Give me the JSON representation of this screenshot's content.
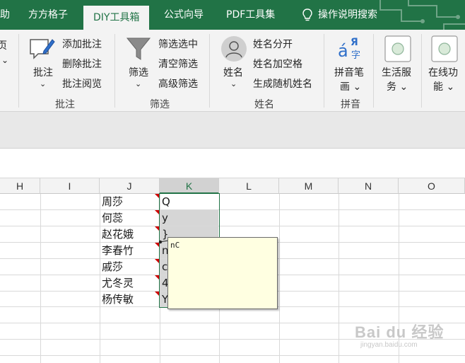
{
  "tabs": [
    {
      "label": "助",
      "active": false
    },
    {
      "label": "方方格子",
      "active": false
    },
    {
      "label": "DIY工具箱",
      "active": true
    },
    {
      "label": "公式向导",
      "active": false
    },
    {
      "label": "PDF工具集",
      "active": false
    }
  ],
  "tell_me": {
    "label": "操作说明搜索"
  },
  "ribbon": {
    "left_cut": {
      "top": "页",
      "bottom": "⌄"
    },
    "comment_group": {
      "large_button": "批注",
      "chevron": "⌄",
      "items": [
        "添加批注",
        "删除批注",
        "批注阅览"
      ],
      "label": "批注"
    },
    "filter_group": {
      "large_button": "筛选",
      "chevron": "⌄",
      "items": [
        "筛选选中",
        "清空筛选",
        "高级筛选"
      ],
      "label": "筛选"
    },
    "name_group": {
      "large_button": "姓名",
      "chevron": "⌄",
      "items": [
        "姓名分开",
        "姓名加空格",
        "生成随机姓名"
      ],
      "label": "姓名"
    },
    "pinyin_group": {
      "icon_letters": "á",
      "icon_cyr": "Я",
      "icon_zi": "字",
      "button_line1": "拼音笔",
      "button_line2": "画 ⌄",
      "label": "拼音"
    },
    "life_service": {
      "line1": "生活服",
      "line2": "务 ⌄"
    },
    "online": {
      "line1": "在线功",
      "line2": "能 ⌄"
    }
  },
  "grid": {
    "columns": [
      "H",
      "I",
      "J",
      "K",
      "L",
      "M",
      "N",
      "O"
    ],
    "selected_column": "K",
    "column_j": [
      "周莎",
      "何蕊",
      "赵花娥",
      "李春竹",
      "戚莎",
      "尤冬灵",
      "杨传敏"
    ],
    "column_k": [
      "Q",
      "y",
      "}",
      "n",
      "c",
      "4",
      "Y"
    ]
  },
  "comment": {
    "text": "nC"
  },
  "watermark": {
    "main": "Bai du 经验",
    "sub": "jingyan.baidu.com"
  },
  "colors": {
    "excel_green": "#217346",
    "ribbon_bg": "#f3f3f3",
    "comment_bg": "#ffffe1",
    "comment_indicator": "#d00000"
  }
}
